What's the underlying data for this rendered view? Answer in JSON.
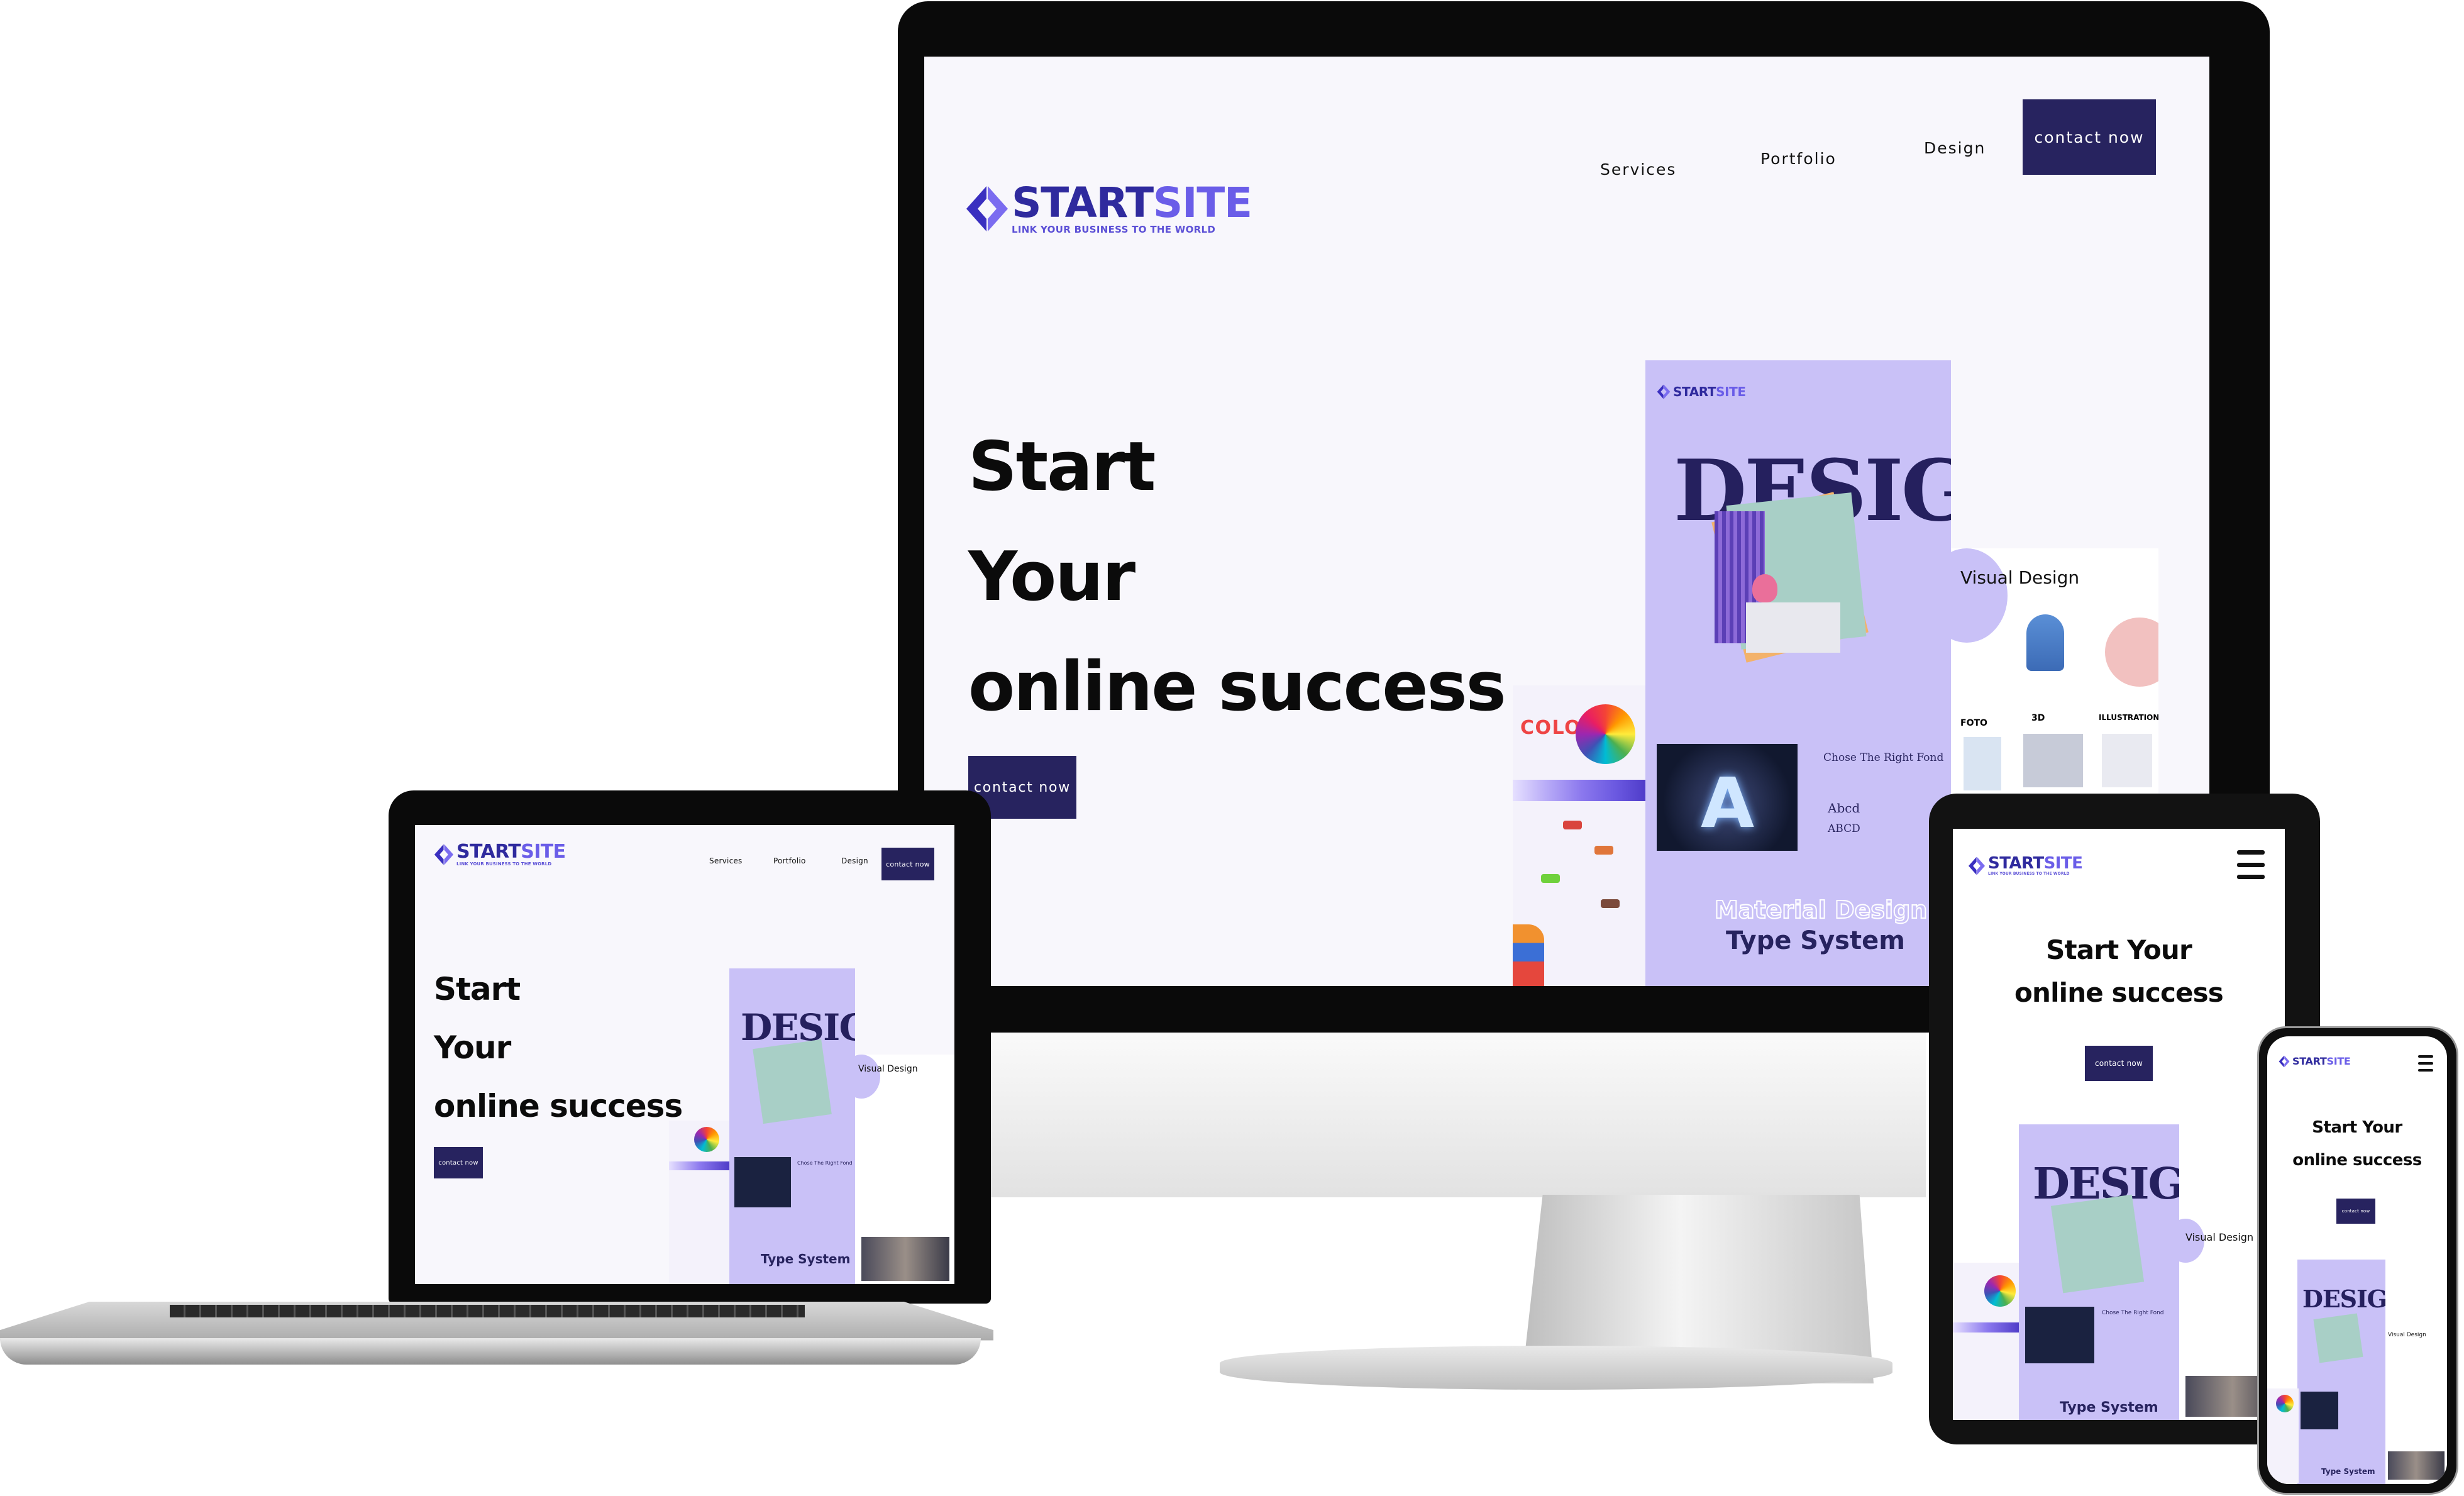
{
  "brand": {
    "name_part1": "START",
    "name_part2": "SITE",
    "tagline": "LINK YOUR BUSINESS TO THE WORLD",
    "accent": "#6a5de8",
    "dark": "#27235f"
  },
  "desktop": {
    "nav": [
      "Services",
      "Portfolio",
      "Design"
    ],
    "cta": "contact now",
    "hero_lines": [
      "Start",
      "Your",
      "online success"
    ]
  },
  "laptop": {
    "nav": [
      "Services",
      "Portfolio",
      "Design"
    ],
    "cta": "contact now",
    "hero_lines": [
      "Start",
      "Your",
      "online success"
    ]
  },
  "tablet": {
    "hero_lines": [
      "Start Your",
      "online success"
    ],
    "cta": "contact now",
    "menu_icon": "hamburger-menu-icon"
  },
  "phone": {
    "hero_lines": [
      "Start Your",
      "online success"
    ],
    "cta": "contact now",
    "menu_icon": "hamburger-menu-icon"
  },
  "showcase": {
    "headline": "DESIGN",
    "visual_design": "Visual Design",
    "foto": "FOTO",
    "three_d": "3D",
    "illustration": "ILLUSTRATION",
    "color": "COLOR",
    "font_title": "Chose The Right Fond",
    "font_sample_1": "Abcd",
    "font_sample_2": "ABCD",
    "material": "Material Design",
    "type_system": "Type System"
  }
}
